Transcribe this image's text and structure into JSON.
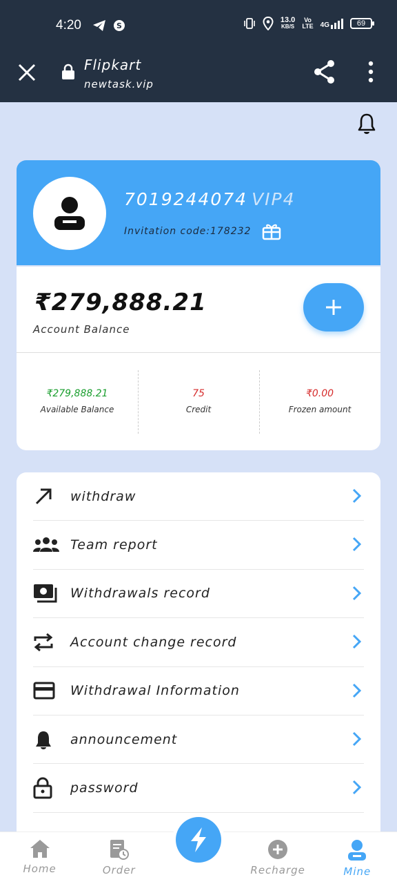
{
  "status_bar": {
    "time": "4:20",
    "speed_value": "13.0",
    "speed_unit": "KB/S",
    "volte_top": "Vo",
    "volte_bottom": "LTE",
    "network": "4G",
    "battery": "69"
  },
  "browser": {
    "title": "Flipkart",
    "domain": "newtask.vip"
  },
  "profile": {
    "phone": "7019244074",
    "vip": "VIP4",
    "invitation": "Invitation code:178232"
  },
  "balance": {
    "amount": "₹279,888.21",
    "label": "Account Balance",
    "stats": [
      {
        "value": "₹279,888.21",
        "label": "Available Balance",
        "color": "#1a9e2e"
      },
      {
        "value": "75",
        "label": "Credit",
        "color": "#d62b2b"
      },
      {
        "value": "₹0.00",
        "label": "Frozen amount",
        "color": "#d62b2b"
      }
    ]
  },
  "menu": [
    {
      "label": "withdraw",
      "icon": "arrow-up-right-icon"
    },
    {
      "label": "Team report",
      "icon": "team-icon"
    },
    {
      "label": "Withdrawals record",
      "icon": "cash-icon"
    },
    {
      "label": "Account change record",
      "icon": "swap-icon"
    },
    {
      "label": "Withdrawal Information",
      "icon": "card-icon"
    },
    {
      "label": "announcement",
      "icon": "bell-icon"
    },
    {
      "label": "password",
      "icon": "lock-icon"
    }
  ],
  "nav": {
    "home": "Home",
    "order": "Order",
    "recharge": "Recharge",
    "mine": "Mine"
  },
  "colors": {
    "accent": "#45a6f6",
    "header": "#243142",
    "background": "#d6e1f7"
  }
}
